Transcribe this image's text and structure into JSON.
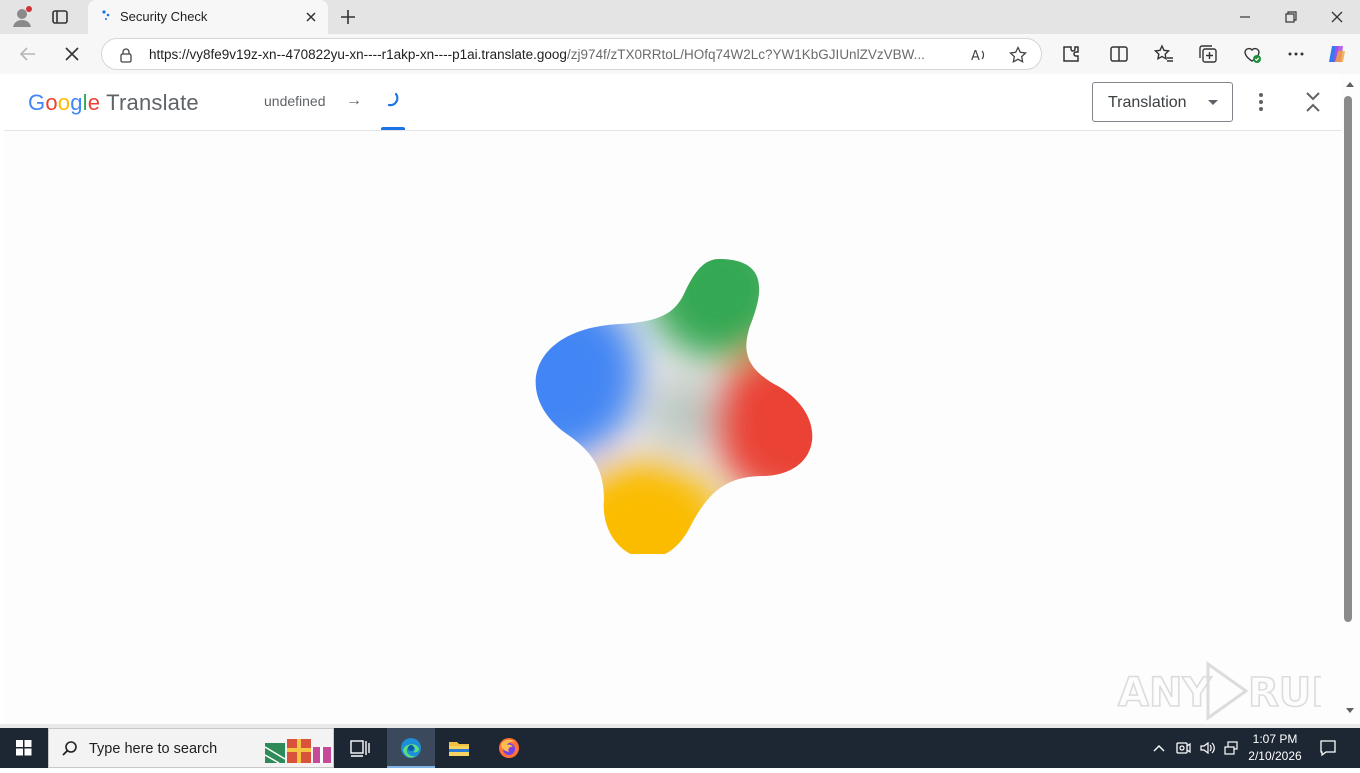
{
  "browser": {
    "tab": {
      "title": "Security Check"
    },
    "address": {
      "url_host": "https://vy8fe9v19z-xn--470822yu-xn----r1akp-xn----p1ai.translate.goog",
      "url_path": "/zj974f/zTX0RRtoL/HOfq74W2Lc?YW1KbGJIUnlZVzVBW..."
    }
  },
  "translate": {
    "logo_google": {
      "G": "G",
      "o1": "o",
      "o2": "o",
      "g": "g",
      "l": "l",
      "e": "e"
    },
    "logo_word": "Translate",
    "source_language": "undefined",
    "arrow": "→",
    "view_select": {
      "selected": "Translation"
    }
  },
  "watermark": {
    "text": "ANY RUN"
  },
  "taskbar": {
    "search_placeholder": "Type here to search",
    "clock": {
      "time": "1:07 PM",
      "date": "2/10/2026"
    }
  },
  "colors": {
    "google_blue": "#4285f4",
    "google_red": "#ea4335",
    "google_yellow": "#fbbc05",
    "google_green": "#34a853",
    "accent": "#1a73e8"
  }
}
